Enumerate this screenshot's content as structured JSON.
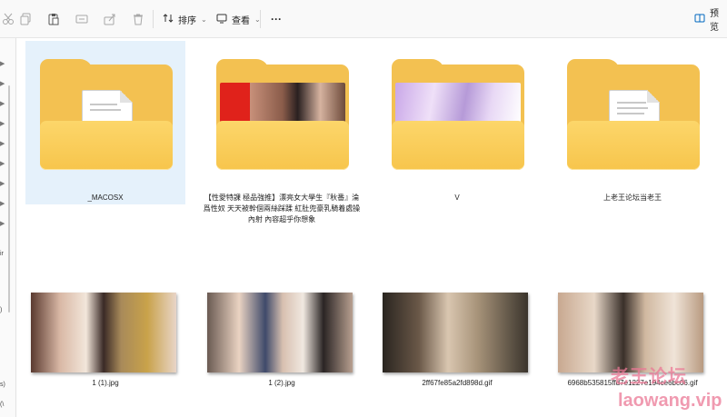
{
  "toolbar": {
    "sort_label": "排序",
    "view_label": "查看",
    "more_label": "···",
    "preview_label": "预览"
  },
  "left_pane": {
    "fragments": [
      "ir",
      ")",
      "s)",
      "(\\"
    ]
  },
  "folders": [
    {
      "name": "_MACOSX",
      "selected": true,
      "icon": "folder-document-icon"
    },
    {
      "name": "【性愛特課 極品強推】漂亮女大學生『秋番』淪爲性奴 天天被幹個兩絲踩蹂 紅肚兜豪乳騎着處操內射 內容超乎你想象",
      "selected": false,
      "icon": "folder-thumbnail-icon"
    },
    {
      "name": "V",
      "selected": false,
      "icon": "folder-thumbnail-icon"
    },
    {
      "name": "上老王论坛当老王",
      "selected": false,
      "icon": "folder-document-icon"
    }
  ],
  "files": [
    {
      "name": "1 (1).jpg"
    },
    {
      "name": "1 (2).jpg"
    },
    {
      "name": "2ff67fe85a2fd898d.gif"
    },
    {
      "name": "6968b535815ffd7e1227e194ce6bc06.gif"
    }
  ],
  "watermark": {
    "line1": "老王论坛",
    "line2": "laowang.vip"
  },
  "colors": {
    "folder": "#f3c151",
    "selection": "#e5f1fb",
    "accent": "#0067c0"
  }
}
